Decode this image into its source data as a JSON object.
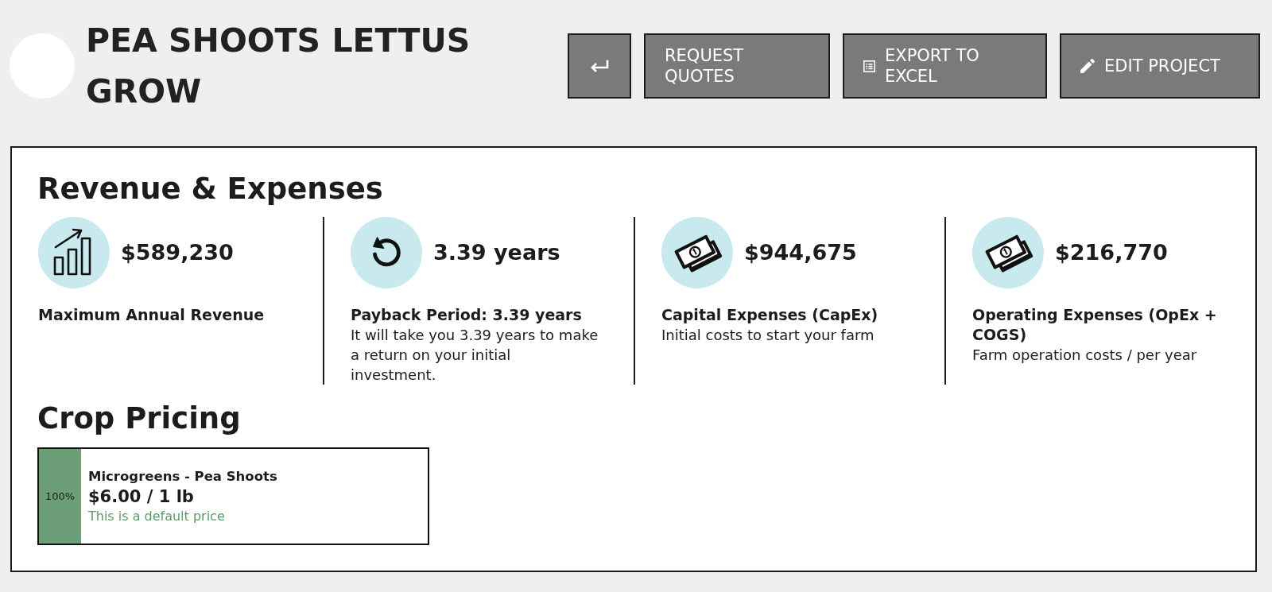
{
  "header": {
    "title": "PEA SHOOTS LETTUS GROW",
    "buttons": [
      {
        "kind": "back"
      },
      {
        "kind": "quotes",
        "label": "REQUEST QUOTES"
      },
      {
        "kind": "export",
        "label": "EXPORT TO EXCEL"
      },
      {
        "kind": "edit",
        "label": "EDIT PROJECT"
      }
    ]
  },
  "revenue_expenses": {
    "title": "Revenue & Expenses",
    "stats": [
      {
        "kind": "revenue",
        "value": "$589,230",
        "label": "Maximum Annual Revenue"
      },
      {
        "kind": "payback",
        "value": "3.39 years",
        "label": "Payback Period: 3.39 years",
        "description": "It will take you 3.39 years to make a return on your initial investment."
      },
      {
        "kind": "money",
        "value": "$944,675",
        "label": "Capital Expenses (CapEx)",
        "description": "Initial costs to start your farm"
      },
      {
        "kind": "money",
        "value": "$216,770",
        "label": "Operating Expenses (OpEx + COGS)",
        "description": "Farm operation costs / per year"
      }
    ]
  },
  "crop_pricing": {
    "title": "Crop Pricing",
    "crops": [
      {
        "share": "100%",
        "name": "Microgreens - Pea Shoots",
        "price": "$6.00 / 1 lb",
        "note": "This is a default price"
      }
    ]
  }
}
